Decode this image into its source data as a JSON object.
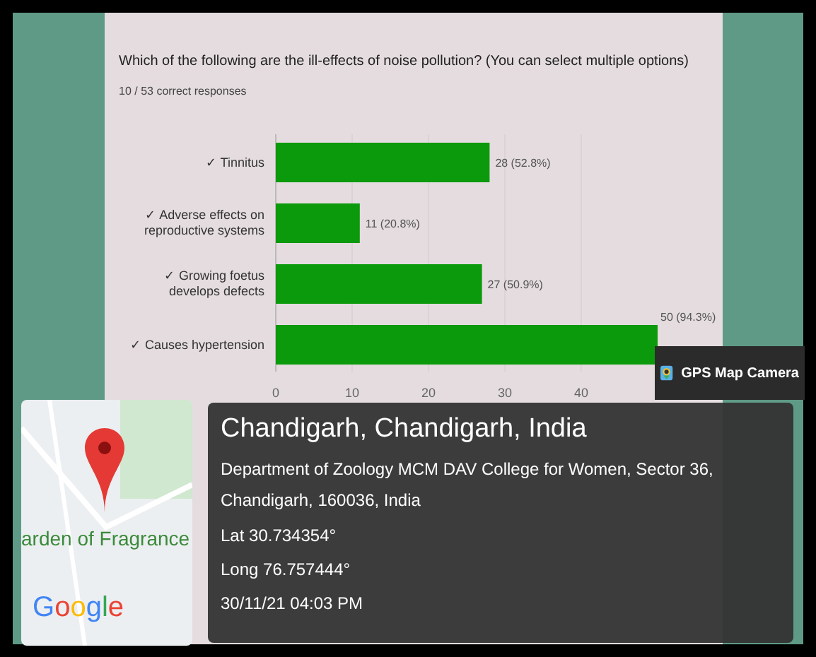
{
  "question": {
    "title": "Which of the following are the ill-effects of noise pollution? (You can select multiple options)",
    "summary": "10 / 53 correct responses",
    "chart_data": {
      "type": "bar",
      "orientation": "horizontal",
      "categories": [
        "✓ Tinnitus",
        "✓ Adverse effects on reproductive systems",
        "✓ Growing foetus develops defects",
        "✓ Causes hypertension"
      ],
      "series": [
        {
          "color": "#0b9a0b",
          "values": [
            28,
            11,
            27,
            50
          ]
        }
      ],
      "grid": true,
      "xlim": [
        0,
        50
      ],
      "xticks": [
        0,
        10,
        20,
        30,
        40
      ],
      "value_labels": [
        "28 (52.8%)",
        "11 (20.8%)",
        "27 (50.9%)",
        "50 (94.3%)"
      ]
    }
  },
  "gps_tag": {
    "label": "GPS Map Camera"
  },
  "map": {
    "place_label": "arden of Fragrance",
    "logo": "Google"
  },
  "location": {
    "title": "Chandigarh, Chandigarh, India",
    "address": "Department of Zoology MCM DAV College for Women, Sector 36, Chandigarh, 160036, India",
    "lat": "Lat 30.734354°",
    "long": "Long 76.757444°",
    "datetime": "30/11/21 04:03 PM"
  }
}
